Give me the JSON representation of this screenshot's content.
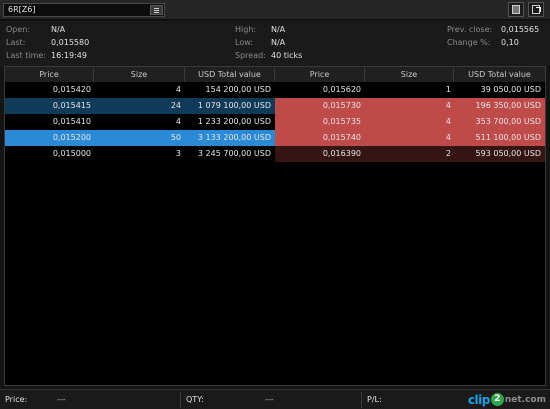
{
  "window": {
    "symbol": "6R[Z6]",
    "buttons": {
      "symbol_list": "list-icon",
      "save_layout": "save-icon",
      "detach": "detach-window-icon"
    }
  },
  "stats": {
    "open_label": "Open:",
    "open_value": "N/A",
    "last_label": "Last:",
    "last_value": "0,015580",
    "last_time_label": "Last time:",
    "last_time_value": "16:19:49",
    "high_label": "High:",
    "high_value": "N/A",
    "low_label": "Low:",
    "low_value": "N/A",
    "spread_label": "Spread:",
    "spread_value": "40 ticks",
    "prev_close_label": "Prev. close:",
    "prev_close_value": "0,015565",
    "change_label": "Change %:",
    "change_value": "0,10"
  },
  "book": {
    "headers": [
      "Price",
      "Size",
      "USD Total value",
      "Price",
      "Size",
      "USD Total value"
    ],
    "bids": [
      {
        "price": "0,015420",
        "size": "4",
        "total": "154 200,00 USD",
        "style": "none"
      },
      {
        "price": "0,015415",
        "size": "24",
        "total": "1 079 100,00 USD",
        "style": "bid-dark"
      },
      {
        "price": "0,015410",
        "size": "4",
        "total": "1 233 200,00 USD",
        "style": "none"
      },
      {
        "price": "0,015200",
        "size": "50",
        "total": "3 133 200,00 USD",
        "style": "bid-bright"
      },
      {
        "price": "0,015000",
        "size": "3",
        "total": "3 245 700,00 USD",
        "style": "none"
      }
    ],
    "asks": [
      {
        "price": "0,015620",
        "size": "1",
        "total": "39 050,00 USD",
        "style": "none"
      },
      {
        "price": "0,015730",
        "size": "4",
        "total": "196 350,00 USD",
        "style": "ask-red"
      },
      {
        "price": "0,015735",
        "size": "4",
        "total": "353 700,00 USD",
        "style": "ask-red"
      },
      {
        "price": "0,015740",
        "size": "4",
        "total": "511 100,00 USD",
        "style": "ask-red"
      },
      {
        "price": "0,016390",
        "size": "2",
        "total": "593 050,00 USD",
        "style": "ask-dark"
      }
    ]
  },
  "bottom": {
    "price_label": "Price:",
    "price_value": "---",
    "qty_label": "QTY:",
    "qty_value": "---",
    "pl_label": "P/L:",
    "pl_value": ""
  },
  "watermark": {
    "part1": "clip",
    "part2": "2",
    "part3": "net.com"
  },
  "colors": {
    "bid_highlight": "#0f3a58",
    "bid_selected": "#2a8ad6",
    "ask_highlight": "#bf4a4a",
    "ask_dark": "#351414"
  }
}
